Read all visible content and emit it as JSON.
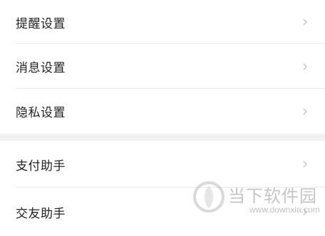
{
  "group1": {
    "items": [
      {
        "label": "提醒设置",
        "chevron": "chevron-right-icon"
      },
      {
        "label": "消息设置",
        "chevron": "chevron-right-icon"
      },
      {
        "label": "隐私设置",
        "chevron": "chevron-right-icon"
      }
    ]
  },
  "group2": {
    "items": [
      {
        "label": "支付助手",
        "chevron": "chevron-right-icon"
      },
      {
        "label": "交友助手",
        "chevron": "chevron-right-icon"
      }
    ]
  },
  "watermark": {
    "title": "当下软件园",
    "url": "www.downxia.com"
  },
  "colors": {
    "background": "#ffffff",
    "separator": "#f2f2f2",
    "divider": "#e9e9e9",
    "text": "#222222",
    "chevron": "#c4c4c4"
  }
}
